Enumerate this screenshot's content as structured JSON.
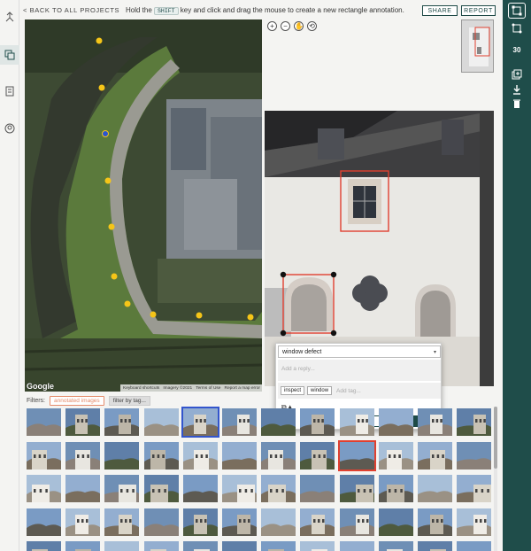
{
  "topbar": {
    "back_label": "< BACK TO ALL PROJECTS",
    "hint_prefix": "Hold the",
    "hint_key": "SHIFT",
    "hint_suffix": "key and click and drag the mouse to create a new rectangle annotation.",
    "share_label": "SHARE",
    "report_label": "REPORT"
  },
  "right_rail": {
    "count_label": "30"
  },
  "map": {
    "logo": "Google",
    "attribution": [
      "Keyboard shortcuts",
      "Imagery ©2021",
      "Terms of Use",
      "Report a map error"
    ],
    "track_color": "#f5c518"
  },
  "zoom_tools": {
    "zoom_in": "+",
    "zoom_out": "−",
    "pan": "✋",
    "reset": "⟲"
  },
  "annotation_popup": {
    "label_value": "window defect",
    "reply_placeholder": "Add a reply...",
    "tags": [
      "inspect",
      "window"
    ],
    "add_tag_placeholder": "Add tag...",
    "cancel_label": "Cancel",
    "ok_label": "Ok"
  },
  "filters": {
    "label": "Filters:",
    "annotated_chip": "annotated images",
    "tag_chip": "filter by tag..."
  },
  "colors": {
    "accent": "#1f4d4a",
    "annotation_red": "#e04030",
    "selection_blue": "#3355cc"
  }
}
